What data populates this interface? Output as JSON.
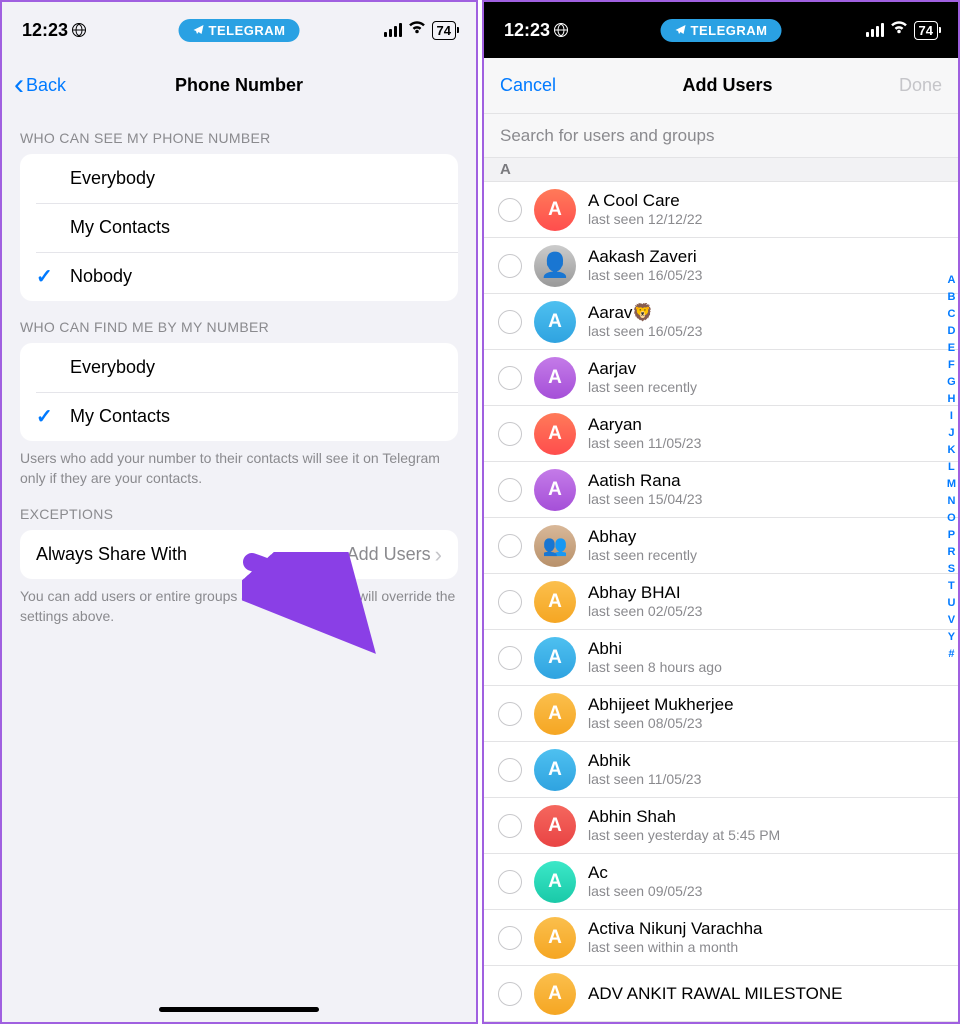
{
  "status": {
    "time": "12:23",
    "pill": "TELEGRAM",
    "battery": "74"
  },
  "left": {
    "back": "Back",
    "title": "Phone Number",
    "sec1_header": "WHO CAN SEE MY PHONE NUMBER",
    "sec1": [
      "Everybody",
      "My Contacts",
      "Nobody"
    ],
    "sec2_header": "WHO CAN FIND ME BY MY NUMBER",
    "sec2": [
      "Everybody",
      "My Contacts"
    ],
    "sec2_footer": "Users who add your number to their contacts will see it on Telegram only if they are your contacts.",
    "sec3_header": "EXCEPTIONS",
    "sec3_label": "Always Share With",
    "sec3_action": "Add Users",
    "sec3_footer": "You can add users or entire groups as exceptions that will override the settings above."
  },
  "right": {
    "cancel": "Cancel",
    "title": "Add Users",
    "done": "Done",
    "search_placeholder": "Search for users and groups",
    "section_letter": "A",
    "contacts": [
      {
        "name": "A Cool Care",
        "sub": "last seen 12/12/22",
        "avatar": "g-orange",
        "initial": "A"
      },
      {
        "name": "Aakash Zaveri",
        "sub": "last seen 16/05/23",
        "avatar": "g-photo",
        "initial": ""
      },
      {
        "name": "Aarav🦁",
        "sub": "last seen 16/05/23",
        "avatar": "g-blue",
        "initial": "A"
      },
      {
        "name": "Aarjav",
        "sub": "last seen recently",
        "avatar": "g-purple",
        "initial": "A"
      },
      {
        "name": "Aaryan",
        "sub": "last seen 11/05/23",
        "avatar": "g-orange",
        "initial": "A"
      },
      {
        "name": "Aatish Rana",
        "sub": "last seen 15/04/23",
        "avatar": "g-purple",
        "initial": "A"
      },
      {
        "name": "Abhay",
        "sub": "last seen recently",
        "avatar": "g-photo2",
        "initial": ""
      },
      {
        "name": "Abhay BHAI",
        "sub": "last seen 02/05/23",
        "avatar": "g-yellow",
        "initial": "A"
      },
      {
        "name": "Abhi",
        "sub": "last seen 8 hours ago",
        "avatar": "g-blue",
        "initial": "A"
      },
      {
        "name": "Abhijeet Mukherjee",
        "sub": "last seen 08/05/23",
        "avatar": "g-yellow",
        "initial": "A"
      },
      {
        "name": "Abhik",
        "sub": "last seen 11/05/23",
        "avatar": "g-blue",
        "initial": "A"
      },
      {
        "name": "Abhin Shah",
        "sub": "last seen yesterday at 5:45 PM",
        "avatar": "g-red",
        "initial": "A"
      },
      {
        "name": "Ac",
        "sub": "last seen 09/05/23",
        "avatar": "g-teal",
        "initial": "A"
      },
      {
        "name": "Activa Nikunj Varachha",
        "sub": "last seen within a month",
        "avatar": "g-yellow",
        "initial": "A"
      },
      {
        "name": "ADV ANKIT RAWAL MILESTONE",
        "sub": "",
        "avatar": "g-yellow",
        "initial": "A"
      }
    ],
    "index": [
      "A",
      "B",
      "C",
      "D",
      "E",
      "F",
      "G",
      "H",
      "I",
      "J",
      "K",
      "L",
      "M",
      "N",
      "O",
      "P",
      "R",
      "S",
      "T",
      "U",
      "V",
      "Y",
      "#"
    ]
  }
}
